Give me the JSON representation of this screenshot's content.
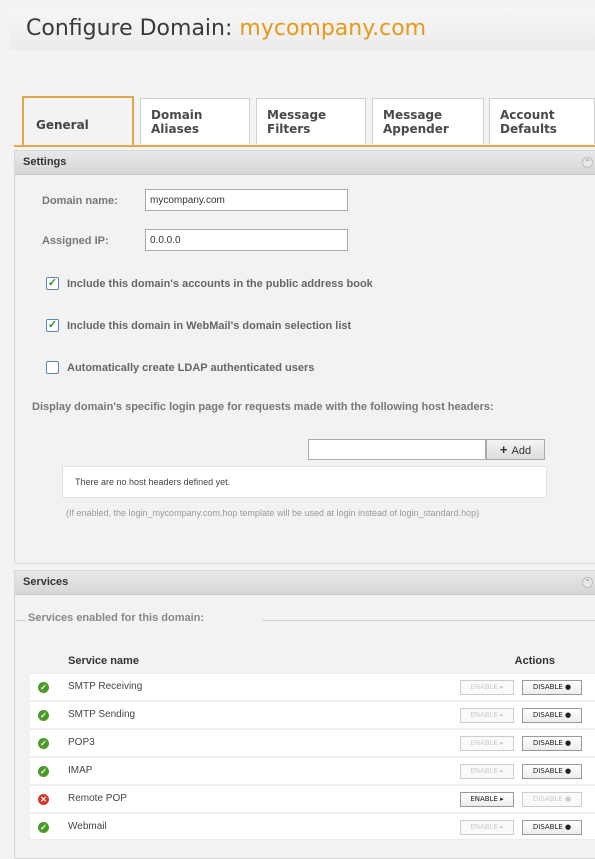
{
  "header": {
    "title_prefix": "Configure Domain: ",
    "domain": "mycompany.com"
  },
  "tabs": [
    {
      "l1": "General",
      "l2": ""
    },
    {
      "l1": "Domain",
      "l2": "Aliases"
    },
    {
      "l1": "Message",
      "l2": "Filters"
    },
    {
      "l1": "Message",
      "l2": "Appender"
    },
    {
      "l1": "Account",
      "l2": "Defaults"
    }
  ],
  "settings": {
    "title": "Settings",
    "domain_name_label": "Domain name:",
    "domain_name_value": "mycompany.com",
    "assigned_ip_label": "Assigned IP:",
    "assigned_ip_value": "0.0.0.0",
    "cb1": {
      "label": "Include this domain's accounts in the public address book",
      "checked": "✓"
    },
    "cb2": {
      "label": "Include this domain in WebMail's domain selection list",
      "checked": "✓"
    },
    "cb3": {
      "label": "Automatically create LDAP authenticated users",
      "checked": ""
    },
    "host_headers_text": "Display domain's specific login page for requests made with the following host headers:",
    "add_label": "Add",
    "add_icon": "+",
    "empty_text": "There are no host headers defined yet.",
    "hint": "(If enabled, the login_mycompany.com.hop template will be used at login instead of login_standard.hop)"
  },
  "services": {
    "title": "Services",
    "legend": "Services enabled for this domain:",
    "col_name": "Service name",
    "col_actions": "Actions",
    "enable_label": "ENABLE ▸",
    "disable_label": "DISABLE ●",
    "rows": [
      {
        "name": "SMTP Receiving",
        "status": "enabled",
        "icon": "✓"
      },
      {
        "name": "SMTP Sending",
        "status": "enabled",
        "icon": "✓"
      },
      {
        "name": "POP3",
        "status": "enabled",
        "icon": "✓"
      },
      {
        "name": "IMAP",
        "status": "enabled",
        "icon": "✓"
      },
      {
        "name": "Remote POP",
        "status": "disabled",
        "icon": "✕"
      },
      {
        "name": "Webmail",
        "status": "enabled",
        "icon": "✓"
      }
    ]
  },
  "colors": {
    "accent": "#e5a548",
    "domain": "#e59a1a",
    "ok": "#4c9a2a",
    "error": "#d23a2a"
  }
}
